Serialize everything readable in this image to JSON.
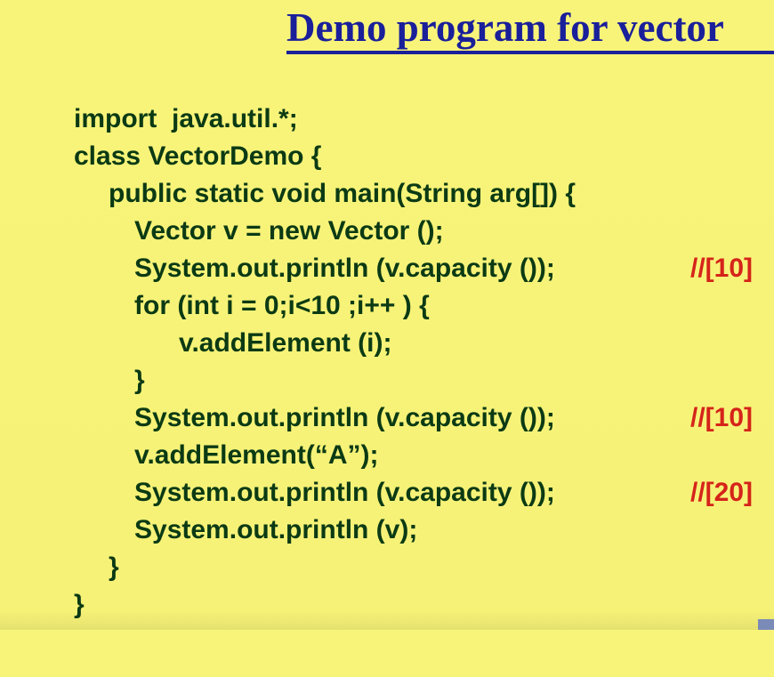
{
  "slide": {
    "title": "Demo program for vector",
    "colors": {
      "background": "#f8f47a",
      "title": "#1a1f9a",
      "code": "#0b3a14",
      "comment": "#d5241a"
    },
    "code_lines": [
      "import  java.util.*;",
      "class VectorDemo {",
      "public static void main(String arg[]) {",
      "Vector v = new Vector ();",
      "System.out.println (v.capacity ());",
      "for (int i = 0;i<10 ;i++ ) {",
      "v.addElement (i);",
      "}",
      "System.out.println (v.capacity ());",
      "v.addElement(“A”);",
      "System.out.println (v.capacity ());",
      "System.out.println (v);",
      "}",
      "}"
    ],
    "comments": {
      "line5": "//[10]",
      "line9": "//[10]",
      "line11": "//[20]"
    }
  }
}
